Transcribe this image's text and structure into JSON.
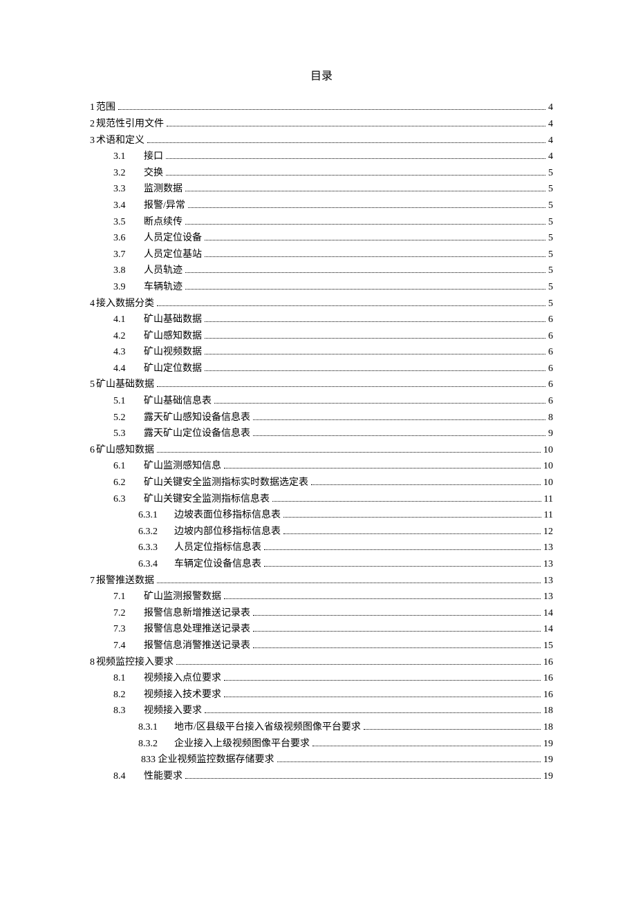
{
  "title": "目录",
  "toc": [
    {
      "level": 0,
      "num": "1",
      "text": "范围",
      "page": "4",
      "joined": true
    },
    {
      "level": 0,
      "num": "2",
      "text": "规范性引用文件",
      "page": "4",
      "joined": true
    },
    {
      "level": 0,
      "num": "3",
      "text": "术语和定义",
      "page": "4",
      "joined": true
    },
    {
      "level": 1,
      "num": "3.1",
      "text": "接口",
      "page": "4"
    },
    {
      "level": 1,
      "num": "3.2",
      "text": "交换",
      "page": "5"
    },
    {
      "level": 1,
      "num": "3.3",
      "text": "监测数据",
      "page": "5"
    },
    {
      "level": 1,
      "num": "3.4",
      "text": "报警/异常",
      "page": "5"
    },
    {
      "level": 1,
      "num": "3.5",
      "text": "断点续传",
      "page": "5"
    },
    {
      "level": 1,
      "num": "3.6",
      "text": "人员定位设备",
      "page": "5"
    },
    {
      "level": 1,
      "num": "3.7",
      "text": "人员定位基站",
      "page": "5"
    },
    {
      "level": 1,
      "num": "3.8",
      "text": "人员轨迹",
      "page": "5"
    },
    {
      "level": 1,
      "num": "3.9",
      "text": "车辆轨迹",
      "page": "5"
    },
    {
      "level": 0,
      "num": "4",
      "text": "接入数据分类",
      "page": "5",
      "joined": true
    },
    {
      "level": 1,
      "num": "4.1",
      "text": "矿山基础数据",
      "page": "6"
    },
    {
      "level": 1,
      "num": "4.2",
      "text": "矿山感知数据",
      "page": "6"
    },
    {
      "level": 1,
      "num": "4.3",
      "text": "矿山视频数据",
      "page": "6"
    },
    {
      "level": 1,
      "num": "4.4",
      "text": "矿山定位数据",
      "page": "6"
    },
    {
      "level": 0,
      "num": "5",
      "text": "矿山基础数据",
      "page": "6",
      "joined": true
    },
    {
      "level": 1,
      "num": "5.1",
      "text": "矿山基础信息表",
      "page": "6"
    },
    {
      "level": 1,
      "num": "5.2",
      "text": "露天矿山感知设备信息表",
      "page": "8"
    },
    {
      "level": 1,
      "num": "5.3",
      "text": "露天矿山定位设备信息表",
      "page": "9"
    },
    {
      "level": 0,
      "num": "6",
      "text": "矿山感知数据",
      "page": "10",
      "joined": true
    },
    {
      "level": 1,
      "num": "6.1",
      "text": "矿山监测感知信息",
      "page": "10"
    },
    {
      "level": 1,
      "num": "6.2",
      "text": "矿山关键安全监测指标实时数据选定表",
      "page": "10"
    },
    {
      "level": 1,
      "num": "6.3",
      "text": "矿山关键安全监测指标信息表",
      "page": "11"
    },
    {
      "level": 2,
      "num": "6.3.1",
      "text": "边坡表面位移指标信息表",
      "page": "11"
    },
    {
      "level": 2,
      "num": "6.3.2",
      "text": "边坡内部位移指标信息表",
      "page": "12"
    },
    {
      "level": 2,
      "num": "6.3.3",
      "text": "人员定位指标信息表",
      "page": "13"
    },
    {
      "level": 2,
      "num": "6.3.4",
      "text": "车辆定位设备信息表",
      "page": "13"
    },
    {
      "level": 0,
      "num": "7",
      "text": "报警推送数据",
      "page": "13",
      "joined": true
    },
    {
      "level": 1,
      "num": "7.1",
      "text": "矿山监测报警数据",
      "page": "13"
    },
    {
      "level": 1,
      "num": "7.2",
      "text": "报警信息新增推送记录表",
      "page": "14"
    },
    {
      "level": 1,
      "num": "7.3",
      "text": "报警信息处理推送记录表",
      "page": "14"
    },
    {
      "level": 1,
      "num": "7.4",
      "text": "报警信息消警推送记录表",
      "page": "15"
    },
    {
      "level": 0,
      "num": "8",
      "text": "视频监控接入要求",
      "page": "16",
      "joined": true
    },
    {
      "level": 1,
      "num": "8.1",
      "text": "视频接入点位要求",
      "page": "16"
    },
    {
      "level": 1,
      "num": "8.2",
      "text": "视频接入技术要求",
      "page": "16"
    },
    {
      "level": 1,
      "num": "8.3",
      "text": "视频接入要求",
      "page": "18"
    },
    {
      "level": 2,
      "num": "8.3.1",
      "text": "地市/区县级平台接入省级视频图像平台要求",
      "page": "18"
    },
    {
      "level": 2,
      "num": "8.3.2",
      "text": "企业接入上级视频图像平台要求",
      "page": "19"
    },
    {
      "level": 2,
      "num": "",
      "text": "833 企业视频监控数据存储要求",
      "page": "19",
      "nonum": true
    },
    {
      "level": 1,
      "num": "8.4",
      "text": "性能要求",
      "page": "19"
    }
  ]
}
